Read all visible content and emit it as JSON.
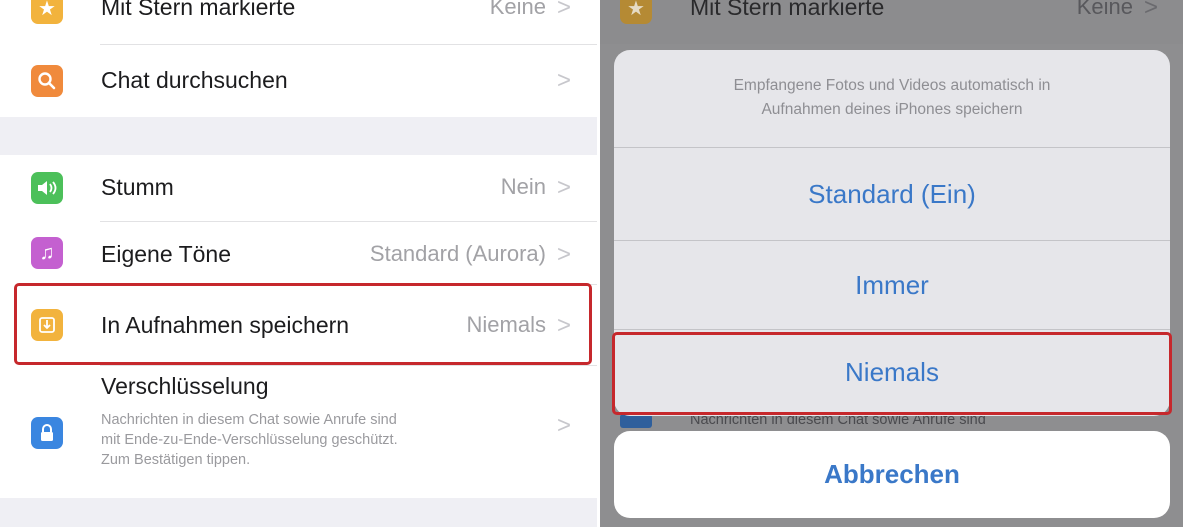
{
  "colors": {
    "starred_icon": "#f2b33d",
    "search_icon": "#f08a3c",
    "mute_icon": "#4cc05a",
    "tones_icon": "#c460d0",
    "save_icon": "#f2b33d",
    "lock_icon": "#3a86e0",
    "action_blue": "#3a78c8",
    "highlight_red": "#c6282c"
  },
  "settings": {
    "starred": {
      "label": "Mit Stern markierte",
      "value": "Keine",
      "icon": "star-icon"
    },
    "search": {
      "label": "Chat durchsuchen",
      "icon": "magnifier-icon"
    },
    "mute": {
      "label": "Stumm",
      "value": "Nein",
      "icon": "speaker-icon"
    },
    "tones": {
      "label": "Eigene Töne",
      "value": "Standard (Aurora)",
      "icon": "music-note-icon"
    },
    "save": {
      "label": "In Aufnahmen speichern",
      "value": "Niemals",
      "icon": "save-to-camera-roll-icon"
    },
    "encryption": {
      "label": "Verschlüsselung",
      "desc_line1": "Nachrichten in diesem Chat sowie Anrufe sind",
      "desc_line2": "mit Ende-zu-Ende-Verschlüsselung geschützt.",
      "desc_line3": "Zum Bestätigen tippen.",
      "icon": "lock-icon"
    },
    "chevron": ">"
  },
  "action_sheet": {
    "message_line1": "Empfangene Fotos und Videos automatisch in",
    "message_line2": "Aufnahmen deines iPhones speichern",
    "options": [
      "Standard (Ein)",
      "Immer",
      "Niemals"
    ],
    "selected": "Niemals",
    "cancel": "Abbrechen",
    "background_text": "Nachrichten in diesem Chat sowie Anrufe sind"
  }
}
